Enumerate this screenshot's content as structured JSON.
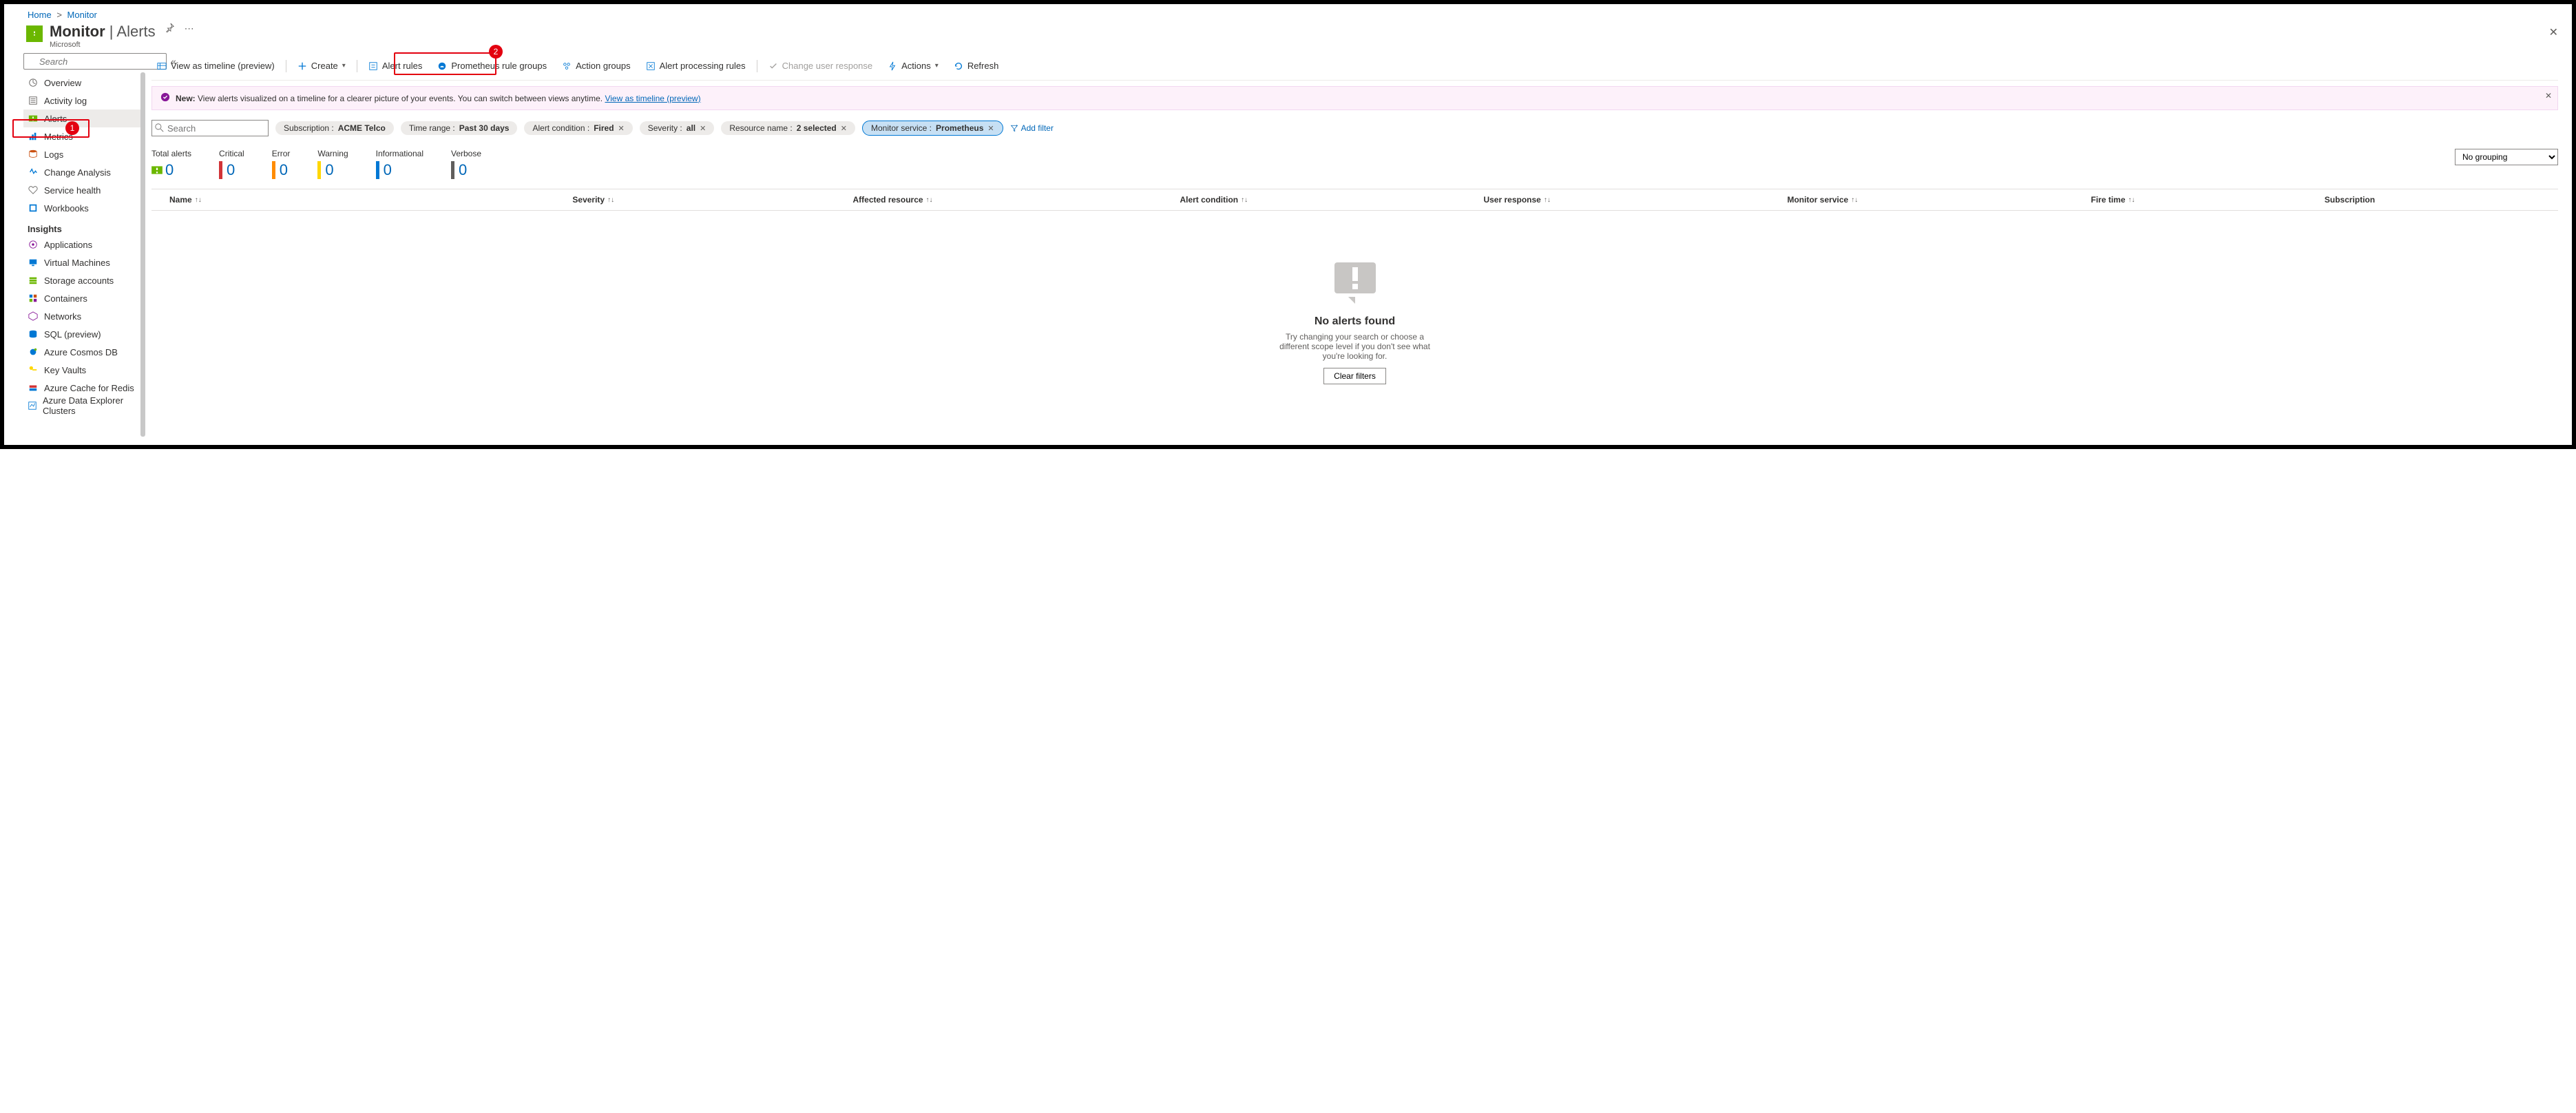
{
  "breadcrumbs": {
    "home": "Home",
    "monitor": "Monitor"
  },
  "header": {
    "title_main": "Monitor",
    "title_sub": "Alerts",
    "org": "Microsoft"
  },
  "sidebar": {
    "search_placeholder": "Search",
    "items": {
      "overview": "Overview",
      "activity_log": "Activity log",
      "alerts": "Alerts",
      "metrics": "Metrics",
      "logs": "Logs",
      "change_analysis": "Change Analysis",
      "service_health": "Service health",
      "workbooks": "Workbooks"
    },
    "insights_label": "Insights",
    "insights": {
      "applications": "Applications",
      "vms": "Virtual Machines",
      "storage": "Storage accounts",
      "containers": "Containers",
      "networks": "Networks",
      "sql": "SQL (preview)",
      "cosmos": "Azure Cosmos DB",
      "keyvaults": "Key Vaults",
      "redis": "Azure Cache for Redis",
      "adx": "Azure Data Explorer Clusters"
    }
  },
  "toolbar": {
    "timeline": "View as timeline (preview)",
    "create": "Create",
    "alert_rules": "Alert rules",
    "prom": "Prometheus rule groups",
    "action_groups": "Action groups",
    "processing": "Alert processing rules",
    "change_resp": "Change user response",
    "actions": "Actions",
    "refresh": "Refresh"
  },
  "banner": {
    "new_label": "New:",
    "text": "View alerts visualized on a timeline for a clearer picture of your events. You can switch between views anytime.",
    "link": "View as timeline (preview)"
  },
  "filters": {
    "search_placeholder": "Search",
    "sub_label": "Subscription : ",
    "sub_val": "ACME Telco",
    "time_label": "Time range : ",
    "time_val": "Past 30 days",
    "cond_label": "Alert condition : ",
    "cond_val": "Fired",
    "sev_label": "Severity : ",
    "sev_val": "all",
    "res_label": "Resource name : ",
    "res_val": "2 selected",
    "svc_label": "Monitor service : ",
    "svc_val": "Prometheus",
    "add": "Add filter"
  },
  "summary": {
    "total_lbl": "Total alerts",
    "total_val": "0",
    "crit_lbl": "Critical",
    "crit_val": "0",
    "err_lbl": "Error",
    "err_val": "0",
    "warn_lbl": "Warning",
    "warn_val": "0",
    "info_lbl": "Informational",
    "info_val": "0",
    "verb_lbl": "Verbose",
    "verb_val": "0",
    "grouping_val": "No grouping"
  },
  "columns": {
    "name": "Name",
    "severity": "Severity",
    "resource": "Affected resource",
    "condition": "Alert condition",
    "response": "User response",
    "service": "Monitor service",
    "fire": "Fire time",
    "subscription": "Subscription"
  },
  "empty": {
    "title": "No alerts found",
    "msg": "Try changing your search or choose a different scope level if you don't see what you're looking for.",
    "btn": "Clear filters"
  },
  "annotations": {
    "badge1": "1",
    "badge2": "2"
  }
}
